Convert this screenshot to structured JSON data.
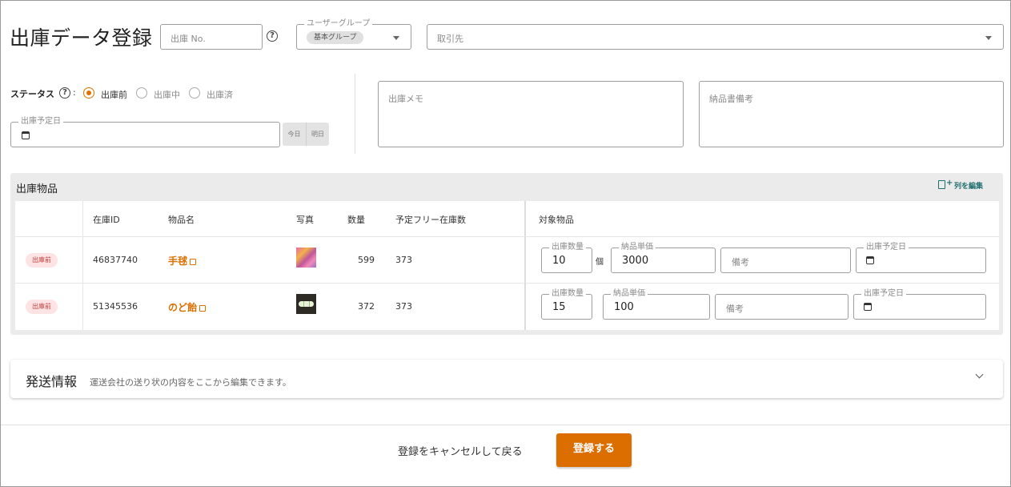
{
  "page": {
    "title": "出庫データ登録"
  },
  "header": {
    "shipment_no_placeholder": "出庫 No.",
    "user_group": {
      "label": "ユーザーグループ",
      "chip": "基本グループ"
    },
    "partner": {
      "placeholder": "取引先"
    }
  },
  "status": {
    "label": "ステータス",
    "colon": ":",
    "options": [
      {
        "label": "出庫前",
        "selected": true
      },
      {
        "label": "出庫中",
        "selected": false
      },
      {
        "label": "出庫済",
        "selected": false
      }
    ]
  },
  "planned_date": {
    "label": "出庫予定日",
    "today_label": "今日",
    "tomorrow_label": "明日"
  },
  "memo": {
    "placeholder": "出庫メモ"
  },
  "delivery_note": {
    "placeholder": "納品書備考"
  },
  "items_section": {
    "title": "出庫物品",
    "edit_columns_label": "列を編集",
    "columns": {
      "stock_id": "在庫ID",
      "item_name": "物品名",
      "photo": "写真",
      "quantity": "数量",
      "free_stock": "予定フリー在庫数",
      "target": "対象物品"
    },
    "field_labels": {
      "qty": "出庫数量",
      "price": "納品単価",
      "remark": "備考",
      "date": "出庫予定日"
    },
    "rows": [
      {
        "status": "出庫前",
        "stock_id": "46837740",
        "name": "手毬",
        "quantity": "599",
        "free_stock": "373",
        "ship_qty": "10",
        "unit": "個",
        "unit_price": "3000"
      },
      {
        "status": "出庫前",
        "stock_id": "51345536",
        "name": "のど飴",
        "quantity": "372",
        "free_stock": "373",
        "ship_qty": "15",
        "unit": "",
        "unit_price": "100"
      }
    ]
  },
  "shipping": {
    "title": "発送情報",
    "description": "運送会社の送り状の内容をここから編集できます。"
  },
  "footer": {
    "cancel_label": "登録をキャンセルして戻る",
    "submit_label": "登録する"
  },
  "colors": {
    "accent": "#dc6e00",
    "badge_bg": "#fde3e3",
    "badge_text": "#c64545",
    "link_teal": "#1f6f6f"
  },
  "icons": {
    "help": "question-circle-icon",
    "calendar": "calendar-icon",
    "external": "external-link-icon",
    "edit_columns": "edit-columns-icon",
    "expand": "chevron-down-icon",
    "dropdown": "caret-down-icon"
  }
}
